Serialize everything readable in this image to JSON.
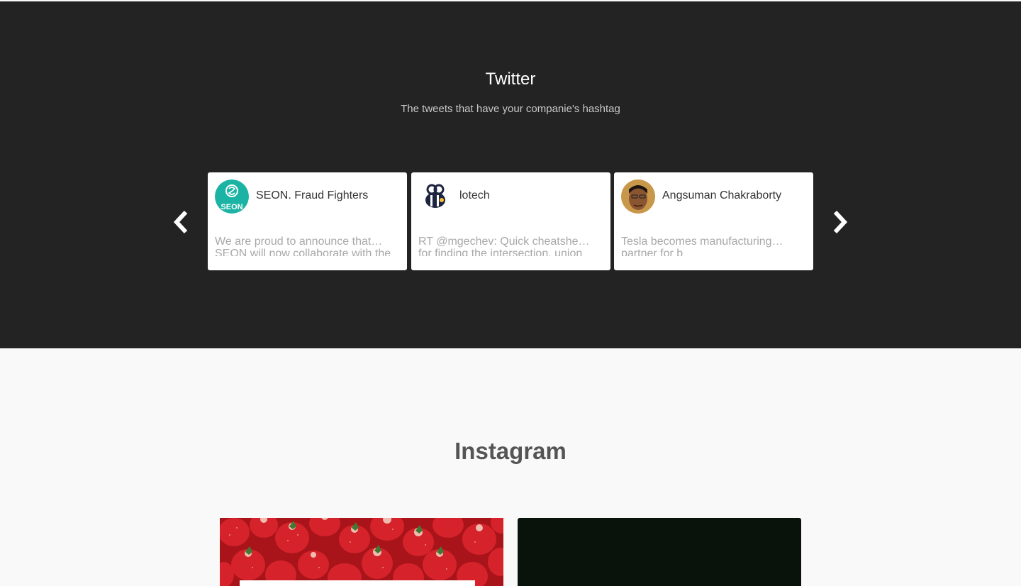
{
  "twitter": {
    "title": "Twitter",
    "subtitle": "The tweets that have your companie's hashtag",
    "prev_icon": "chevron-left-icon",
    "next_icon": "chevron-right-icon",
    "tweets": [
      {
        "author": "SEON. Fraud Fighters",
        "avatar_text": "SEON",
        "avatar_color": "#1bb3a4",
        "text_line1": "We are proud to announce that…",
        "text_line2": "SEON will now collaborate with the"
      },
      {
        "author": "lotech",
        "avatar_color": "#1d2541",
        "text_line1": "RT @mgechev: Quick cheatsheet…",
        "text_line2": "for finding the intersection, union"
      },
      {
        "author": "Angsuman Chakraborty",
        "avatar_color": "#b8742a",
        "text_line1": "Tesla becomes manufacturing…",
        "text_line2": "partner for b"
      }
    ]
  },
  "instagram": {
    "title": "Instagram"
  },
  "colors": {
    "twitter_bg": "#232323",
    "page_bg": "#f9f9f9",
    "card_bg": "#ffffff",
    "tweet_text": "#a8a8a8"
  }
}
